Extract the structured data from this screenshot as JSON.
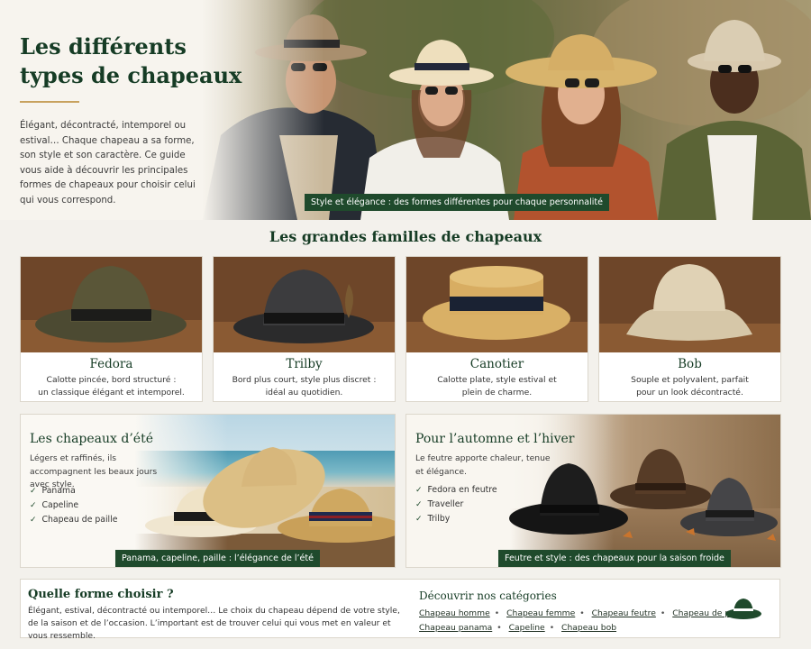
{
  "hero": {
    "title_line1": "Les différents",
    "title_line2": "types de chapeaux",
    "intro": "Élégant, décontracté, intemporel ou estival… Chaque chapeau a sa forme, son style et son caractère. Ce guide vous aide à découvrir les principales formes de chapeaux pour choisir celui qui vous correspond.",
    "caption": "Style et élégance : des formes différentes pour chaque personnalité"
  },
  "families": {
    "title": "Les grandes familles de chapeaux",
    "cards": [
      {
        "name": "Fedora",
        "desc_line1": "Calotte pincée, bord structuré :",
        "desc_line2": "un classique élégant et intemporel."
      },
      {
        "name": "Trilby",
        "desc_line1": "Bord plus court, style plus discret :",
        "desc_line2": "idéal au quotidien."
      },
      {
        "name": "Canotier",
        "desc_line1": "Calotte plate, style estival et",
        "desc_line2": "plein de charme."
      },
      {
        "name": "Bob",
        "desc_line1": "Souple et polyvalent, parfait",
        "desc_line2": "pour un look décontracté."
      }
    ]
  },
  "summer": {
    "title": "Les chapeaux d’été",
    "text": "Légers et raffinés, ils accompagnent les beaux jours avec style.",
    "items": [
      "Panama",
      "Capeline",
      "Chapeau de paille"
    ],
    "caption": "Panama, capeline, paille : l’élégance de l’été"
  },
  "winter": {
    "title": "Pour l’automne et l’hiver",
    "text": "Le feutre apporte chaleur, tenue et élégance.",
    "items": [
      "Fedora en feutre",
      "Traveller",
      "Trilby"
    ],
    "caption": "Feutre et style : des chapeaux pour la saison froide"
  },
  "bottom": {
    "question": "Quelle forme choisir ?",
    "text": "Élégant, estival, décontracté ou intemporel… Le choix du chapeau dépend de votre style, de la saison et de l’occasion. L’important est de trouver celui qui vous met en valeur et vous ressemble.",
    "categories_title": "Découvrir nos catégories",
    "links": [
      "Chapeau homme",
      "Chapeau femme",
      "Chapeau feutre",
      "Chapeau de paille",
      "Chapeau panama",
      "Capeline",
      "Chapeau bob"
    ]
  },
  "icons": {
    "check": "check-icon",
    "hat": "hat-icon"
  },
  "colors": {
    "accent_green": "#1f4a2c",
    "title_green": "#163c25",
    "gold_rule": "#c8a25e"
  }
}
